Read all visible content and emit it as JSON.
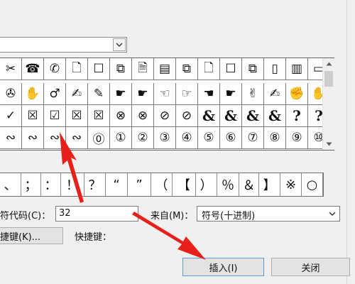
{
  "font_select": {
    "value": "",
    "dropdown_icon": "chevron-down-icon"
  },
  "symbol_grid": {
    "rows": [
      [
        "✂",
        "☎",
        "✆",
        "🗋",
        "☐",
        "⧉",
        "🗎",
        "▤",
        "⧉",
        "🗋",
        "☐",
        "⧉",
        "▯",
        "▥",
        "▭"
      ],
      [
        "✇",
        "✋",
        "♂",
        "✍",
        "✎",
        "☛",
        "☛",
        "☜",
        "☞",
        "☚",
        "☛",
        "✌",
        "✍",
        "✊",
        "✋"
      ],
      [
        "✓",
        "☒",
        "☑",
        "☒",
        "☒",
        "⊗",
        "⊗",
        "⊘",
        "⊘",
        "&",
        "&",
        "&",
        "&",
        "?",
        "?"
      ],
      [
        "∾",
        "∾",
        "∾",
        "∾",
        "⓪",
        "①",
        "②",
        "③",
        "④",
        "⑤",
        "⑥",
        "⑦",
        "⑧",
        "⑨",
        "⑩"
      ]
    ],
    "scroll_up_icon": "triangle-up-icon",
    "scroll_down_icon": "triangle-down-icon"
  },
  "recent_symbols": [
    "、",
    "；",
    "：",
    "！",
    "？",
    "“",
    "”",
    "（",
    "【",
    "）",
    "％",
    "＆",
    "】",
    "※",
    "○"
  ],
  "character_code": {
    "label": "符代码(C)：",
    "value": "32"
  },
  "from": {
    "label": "来自(M)：",
    "value": "符号(十进制)"
  },
  "shortcut_button": {
    "label": "捷键(K)..."
  },
  "shortcut_key": {
    "label": "快捷键："
  },
  "buttons": {
    "insert": "插入(I)",
    "close": "关闭"
  },
  "colors": {
    "annotation_arrow": "#e8201c",
    "insert_border": "#5b9bd5"
  }
}
